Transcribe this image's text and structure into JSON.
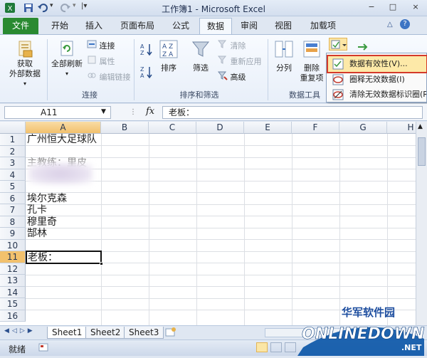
{
  "window": {
    "title": "工作簿1 - Microsoft Excel",
    "controls": [
      "−",
      "□",
      "×"
    ]
  },
  "ribbon_tabs": [
    "文件",
    "开始",
    "插入",
    "页面布局",
    "公式",
    "数据",
    "审阅",
    "视图",
    "加载项"
  ],
  "active_tab": "数据",
  "ribbon": {
    "get_external_data": "获取\n外部数据",
    "refresh_all": "全部刷新",
    "connections": "连接",
    "properties": "属性",
    "edit_links": "编辑链接",
    "group_connections": "连接",
    "sort": "排序",
    "filter": "筛选",
    "clear": "清除",
    "reapply": "重新应用",
    "advanced": "高级",
    "group_sort_filter": "排序和筛选",
    "text_to_columns": "分列",
    "remove_duplicates_1": "删除",
    "remove_duplicates_2": "重复项",
    "group_data_tools": "数据工具"
  },
  "dropdown": {
    "items": [
      "数据有效性(V)...",
      "圈释无效数据(I)",
      "清除无效数据标识圈(R)"
    ],
    "highlighted_index": 0
  },
  "formula_bar": {
    "name_box": "A11",
    "fx": "fx",
    "content": "老板："
  },
  "columns": [
    "A",
    "B",
    "C",
    "D",
    "E",
    "F",
    "G",
    "H"
  ],
  "selected_column": "A",
  "rows": [
    "1",
    "2",
    "3",
    "4",
    "5",
    "6",
    "7",
    "8",
    "9",
    "10",
    "11",
    "12",
    "13",
    "14",
    "15",
    "16"
  ],
  "selected_row": "11",
  "cells": {
    "A1": "广州恒大足球队",
    "A3": "主教练：里皮",
    "A6": "埃尔克森",
    "A7": "孔卡",
    "A8": "穆里奇",
    "A9": "郜林",
    "A11": "老板："
  },
  "sheets": [
    "Sheet1",
    "Sheet2",
    "Sheet3"
  ],
  "active_sheet": "Sheet1",
  "status": {
    "mode": "就绪"
  },
  "watermark": {
    "line1": "华军软件园",
    "line2": "ONLINEDOWN",
    "suffix": ".NET"
  },
  "colors": {
    "file_tab": "#2a8a31",
    "highlight": "#fde9a8",
    "highlight_border": "#d43a2a",
    "selected_header": "#f2c16d"
  }
}
